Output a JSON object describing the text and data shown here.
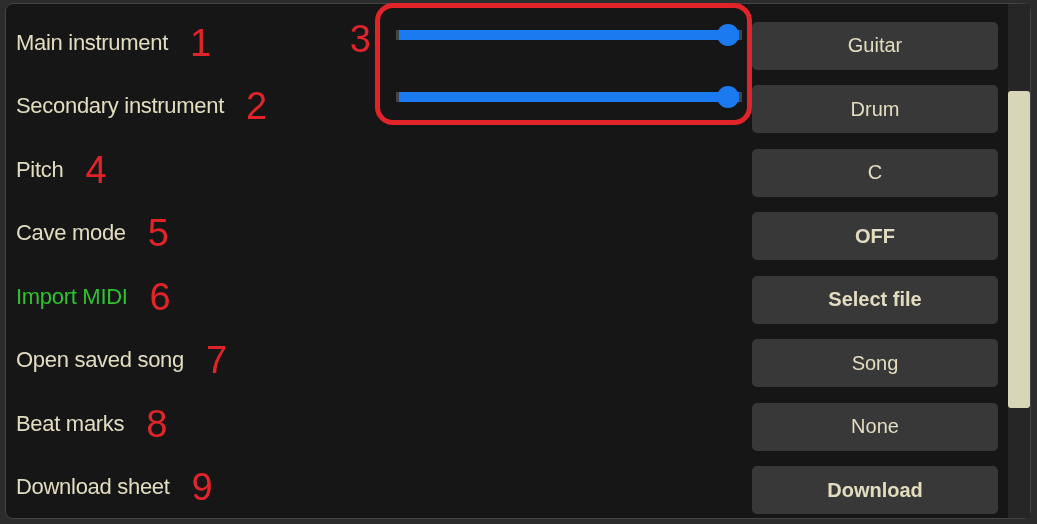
{
  "settings": [
    {
      "label": "Main instrument",
      "number": "1",
      "highlight": false,
      "kind": "slider",
      "level": 1,
      "button": {
        "text": "Guitar",
        "bold": false
      }
    },
    {
      "label": "Secondary instrument",
      "number": "2",
      "highlight": false,
      "kind": "slider",
      "level": 1,
      "button": {
        "text": "Drum",
        "bold": false
      }
    },
    {
      "label": "Pitch",
      "number": "4",
      "highlight": false,
      "kind": "plain",
      "button": {
        "text": "C",
        "bold": false
      }
    },
    {
      "label": "Cave mode",
      "number": "5",
      "highlight": false,
      "kind": "plain",
      "button": {
        "text": "OFF",
        "bold": true
      }
    },
    {
      "label": "Import MIDI",
      "number": "6",
      "highlight": true,
      "kind": "plain",
      "button": {
        "text": "Select file",
        "bold": true
      }
    },
    {
      "label": "Open saved song",
      "number": "7",
      "highlight": false,
      "kind": "plain",
      "button": {
        "text": "Song",
        "bold": false
      }
    },
    {
      "label": "Beat marks",
      "number": "8",
      "highlight": false,
      "kind": "plain",
      "button": {
        "text": "None",
        "bold": false
      }
    },
    {
      "label": "Download sheet",
      "number": "9",
      "highlight": false,
      "kind": "plain",
      "button": {
        "text": "Download",
        "bold": true
      }
    }
  ],
  "slider_callout": {
    "number": "3"
  }
}
